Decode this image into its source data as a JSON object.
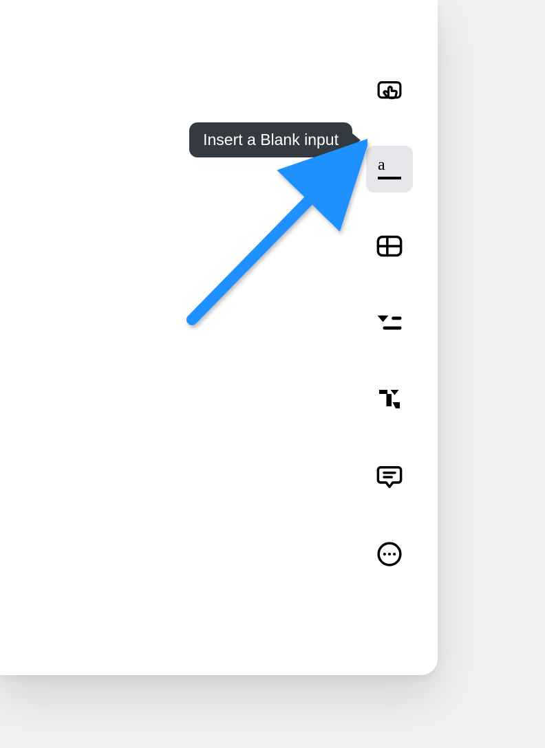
{
  "tooltip": {
    "text": "Insert a Blank input"
  },
  "tools": {
    "interactive_button": "interactive-button",
    "blank_input": "blank-input",
    "table": "table",
    "dropdown_list": "dropdown-list",
    "formatting": "formatting",
    "comment": "comment",
    "more": "more"
  },
  "blank_glyph_label": "a",
  "colors": {
    "tooltip_bg": "#333a42",
    "active_bg": "#e6e7ea",
    "arrow": "#1e90ff"
  }
}
